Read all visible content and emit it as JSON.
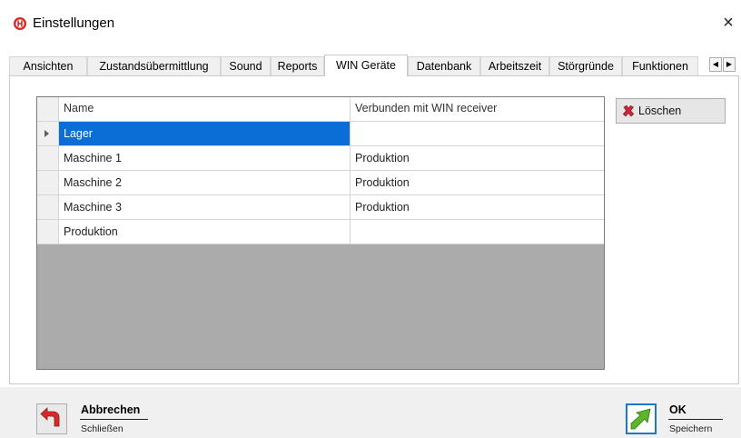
{
  "window": {
    "title": "Einstellungen",
    "close_glyph": "×"
  },
  "tabs": [
    {
      "label": "Ansichten",
      "active": false
    },
    {
      "label": "Zustandsübermittlung",
      "active": false
    },
    {
      "label": "Sound",
      "active": false
    },
    {
      "label": "Reports",
      "active": false
    },
    {
      "label": "WIN Geräte",
      "active": true
    },
    {
      "label": "Datenbank",
      "active": false
    },
    {
      "label": "Arbeitszeit",
      "active": false
    },
    {
      "label": "Störgründe",
      "active": false
    },
    {
      "label": "Funktionen",
      "active": false
    }
  ],
  "grid": {
    "columns": [
      "Name",
      "Verbunden mit WIN receiver"
    ],
    "rows": [
      {
        "name": "Lager",
        "receiver": "",
        "selected": true
      },
      {
        "name": "Maschine 1",
        "receiver": "Produktion",
        "selected": false
      },
      {
        "name": "Maschine 2",
        "receiver": "Produktion",
        "selected": false
      },
      {
        "name": "Maschine 3",
        "receiver": "Produktion",
        "selected": false
      },
      {
        "name": "Produktion",
        "receiver": "",
        "selected": false
      }
    ]
  },
  "actions": {
    "delete_label": "Löschen"
  },
  "footer": {
    "cancel_label": "Abbrechen",
    "cancel_sub": "Schließen",
    "ok_label": "OK",
    "ok_sub": "Speichern"
  },
  "colors": {
    "selection": "#0a6ed6",
    "accent_red": "#d42a2a",
    "ok_green": "#5cb52a",
    "ok_border": "#1c78c4"
  }
}
